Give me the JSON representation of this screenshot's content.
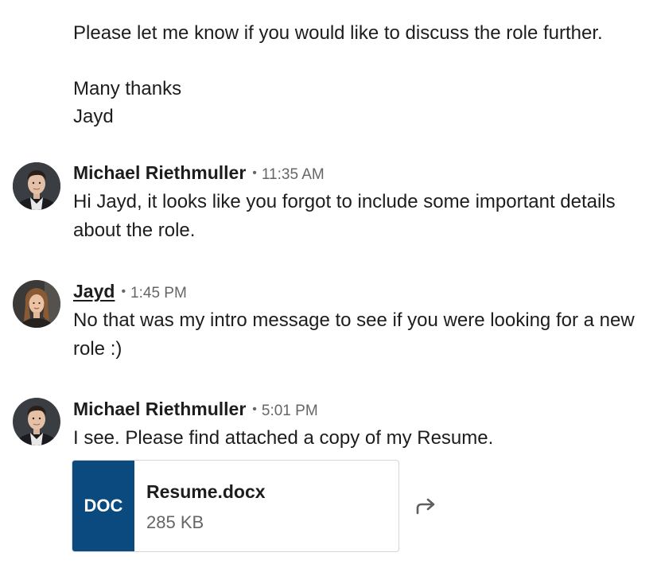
{
  "intro": {
    "lines": [
      "Please let me know if you would like to discuss the role further.",
      "",
      "Many thanks",
      "Jayd"
    ]
  },
  "messages": [
    {
      "sender": "Michael Riethmuller",
      "time": "11:35 AM",
      "text": "Hi Jayd, it looks like you forgot to include some important details about the role."
    },
    {
      "sender": "Jayd",
      "time": "1:45 PM",
      "text": "No that was my intro message to see if you were looking for a new role :)"
    },
    {
      "sender": "Michael Riethmuller",
      "time": "5:01 PM",
      "text": "I see. Please find attached a copy of my Resume."
    }
  ],
  "separator": "•",
  "attachment": {
    "type_label": "DOC",
    "file_name": "Resume.docx",
    "file_size": "285 KB"
  },
  "icons": {
    "forward": "forward-arrow-icon"
  },
  "colors": {
    "doc_tile": "#0a4a7f",
    "meta_text": "#666666",
    "body_text": "#1d1d1d"
  }
}
